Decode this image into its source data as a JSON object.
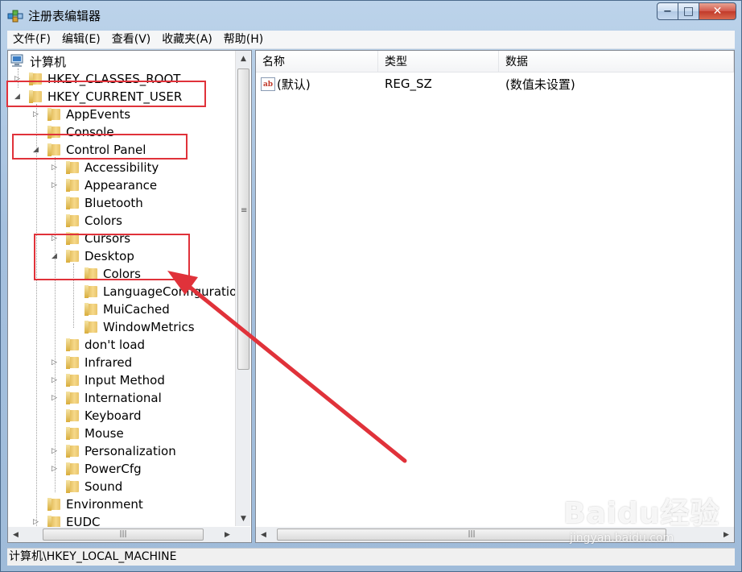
{
  "window": {
    "title": "注册表编辑器"
  },
  "window_controls": {
    "minimize": "−",
    "maximize": "□",
    "close": "✕"
  },
  "menu": [
    "文件(F)",
    "编辑(E)",
    "查看(V)",
    "收藏夹(A)",
    "帮助(H)"
  ],
  "tree": {
    "root": "计算机",
    "items": [
      {
        "label": "HKEY_CLASSES_ROOT",
        "expander": "▷"
      },
      {
        "label": "HKEY_CURRENT_USER",
        "expander": "◢"
      },
      {
        "label": "AppEvents",
        "expander": "▷"
      },
      {
        "label": "Console",
        "expander": ""
      },
      {
        "label": "Control Panel",
        "expander": "◢"
      },
      {
        "label": "Accessibility",
        "expander": "▷"
      },
      {
        "label": "Appearance",
        "expander": "▷"
      },
      {
        "label": "Bluetooth",
        "expander": ""
      },
      {
        "label": "Colors",
        "expander": ""
      },
      {
        "label": "Cursors",
        "expander": "▷"
      },
      {
        "label": "Desktop",
        "expander": "◢"
      },
      {
        "label": "Colors",
        "expander": ""
      },
      {
        "label": "LanguageConfiguratio",
        "expander": ""
      },
      {
        "label": "MuiCached",
        "expander": ""
      },
      {
        "label": "WindowMetrics",
        "expander": ""
      },
      {
        "label": "don't load",
        "expander": ""
      },
      {
        "label": "Infrared",
        "expander": "▷"
      },
      {
        "label": "Input Method",
        "expander": "▷"
      },
      {
        "label": "International",
        "expander": "▷"
      },
      {
        "label": "Keyboard",
        "expander": ""
      },
      {
        "label": "Mouse",
        "expander": ""
      },
      {
        "label": "Personalization",
        "expander": "▷"
      },
      {
        "label": "PowerCfg",
        "expander": "▷"
      },
      {
        "label": "Sound",
        "expander": ""
      },
      {
        "label": "Environment",
        "expander": ""
      },
      {
        "label": "EUDC",
        "expander": "▷"
      }
    ]
  },
  "list": {
    "columns": [
      "名称",
      "类型",
      "数据"
    ],
    "rows": [
      {
        "name": "(默认)",
        "type": "REG_SZ",
        "data": "(数值未设置)",
        "icon": "ab"
      }
    ]
  },
  "status": "计算机\\HKEY_LOCAL_MACHINE",
  "watermark": {
    "brand": "Baidu经验",
    "sub": "jingyan.baidu.com"
  },
  "colors": {
    "highlight": "#e0323a",
    "arrow": "#e0323a"
  },
  "icons": {
    "app": "registry-editor-icon",
    "computer": "computer-icon",
    "folder": "folder-icon",
    "string_value": "reg-string-icon"
  }
}
